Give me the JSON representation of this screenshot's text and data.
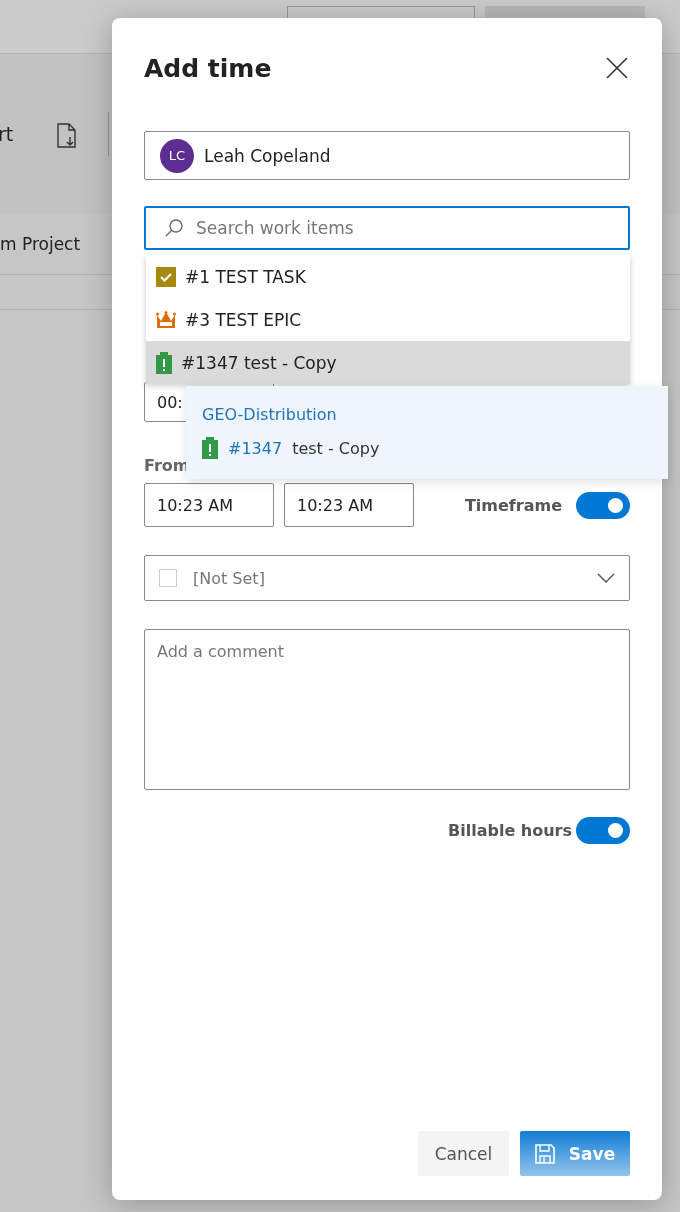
{
  "background": {
    "toolbar_text": "rt",
    "tab_text": "m Project"
  },
  "dialog": {
    "title": "Add time"
  },
  "user": {
    "initials": "LC",
    "name": "Leah Copeland"
  },
  "search": {
    "placeholder": "Search work items"
  },
  "results": [
    {
      "kind": "task",
      "label": "#1 TEST TASK",
      "selected": false
    },
    {
      "kind": "epic",
      "label": "#3 TEST EPIC",
      "selected": false
    },
    {
      "kind": "requirement",
      "label": "#1347 test - Copy",
      "selected": true
    }
  ],
  "tooltip": {
    "project": "GEO-Distribution",
    "kind": "requirement",
    "number": "#1347",
    "title": "test - Copy"
  },
  "duration": {
    "value": "00:"
  },
  "time_range": {
    "label": "From",
    "start": "10:23 AM",
    "end": "10:23 AM",
    "toggle_label": "Timeframe",
    "on": true
  },
  "activity": {
    "value": "[Not Set]",
    "checked": false
  },
  "comment": {
    "placeholder": "Add a comment"
  },
  "billable": {
    "label": "Billable hours",
    "on": true
  },
  "buttons": [
    {
      "kind": "secondary",
      "label": "Cancel"
    },
    {
      "kind": "primary",
      "label": "Save"
    }
  ]
}
